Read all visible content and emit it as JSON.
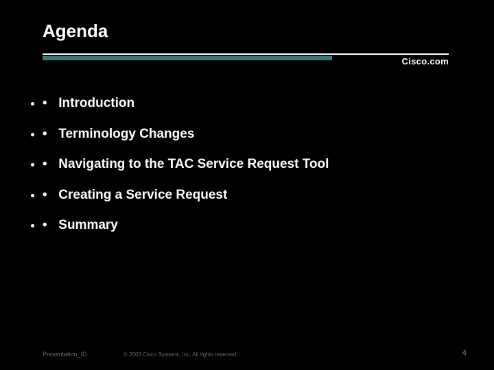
{
  "title": "Agenda",
  "brand": "Cisco.com",
  "bullets": [
    "Introduction",
    "Terminology Changes",
    "Navigating to the TAC Service Request Tool",
    "Creating a Service Request",
    "Summary"
  ],
  "footer": {
    "left": "Presentation_ID",
    "center": "© 2003 Cisco Systems, Inc. All rights reserved.",
    "right": "4"
  }
}
